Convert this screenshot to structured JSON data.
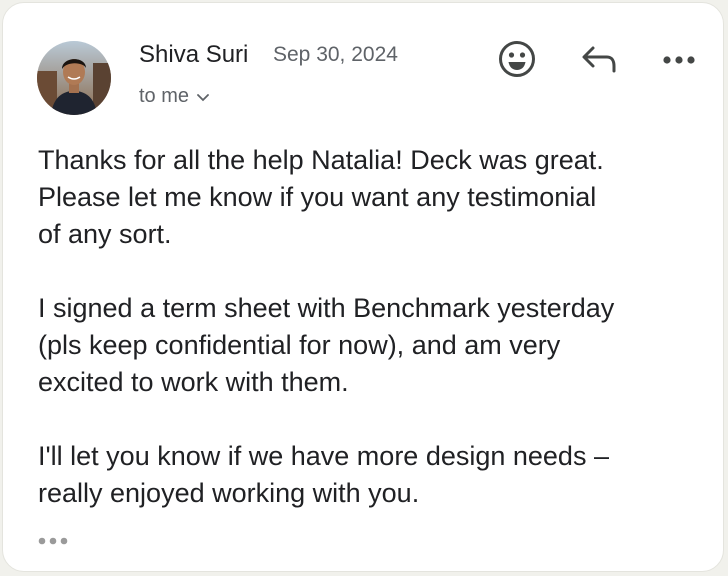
{
  "message": {
    "sender_name": "Shiva Suri",
    "date": "Sep 30, 2024",
    "recipient": "to me",
    "body_paragraphs": [
      "Thanks for all the help Natalia! Deck was great.\nPlease let me know if you want any testimonial\nof any sort.",
      "I signed a term sheet with Benchmark yesterday\n(pls keep confidential for now), and am very\nexcited to work with them.",
      "I'll let you know if we have more design needs –\nreally enjoyed working with you."
    ]
  },
  "actions": {
    "emoji_icon": "smiley-face-icon",
    "reply_icon": "reply-arrow-icon",
    "more_icon": "more-horizontal-icon"
  },
  "recipient_icon": "chevron-down-icon",
  "trimmed_content_icon": "ellipsis-icon",
  "colors": {
    "text_primary": "#202124",
    "text_secondary": "#5f6368",
    "icon": "#444746",
    "background": "#ffffff"
  }
}
